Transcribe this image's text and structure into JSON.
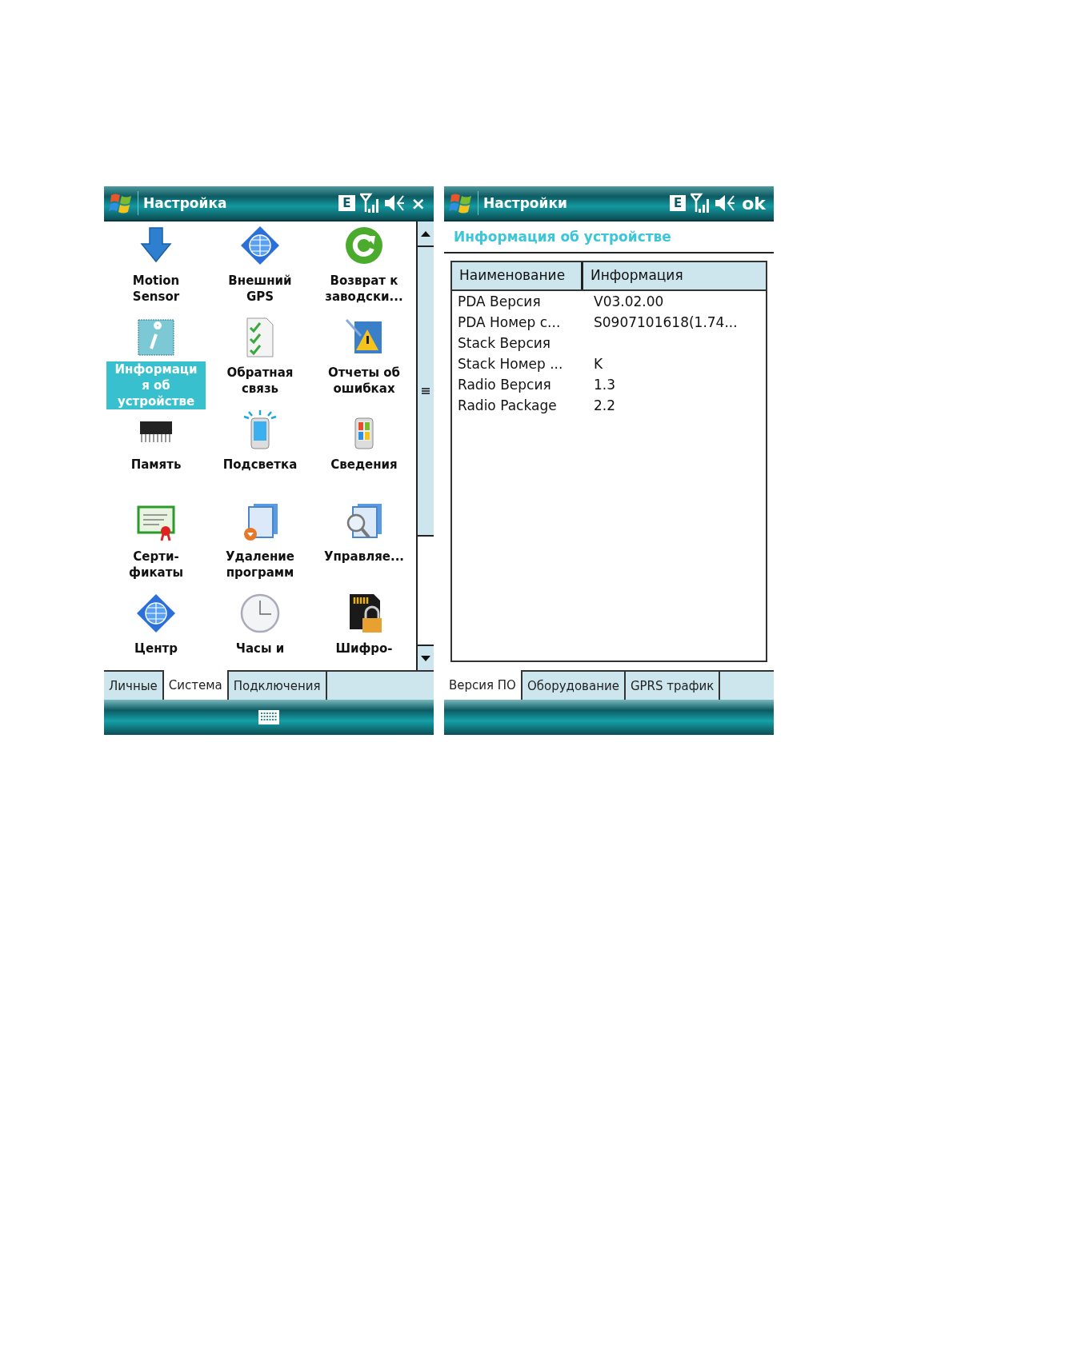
{
  "screens": [
    {
      "kind": "grid",
      "title": "Настройка",
      "network": "E",
      "action": "×",
      "keyboard": true,
      "items": [
        {
          "kind": "arrow",
          "lines": [
            "Motion",
            "Sensor"
          ],
          "selected": false
        },
        {
          "kind": "globe",
          "lines": [
            "Внешний",
            "GPS"
          ],
          "selected": false
        },
        {
          "kind": "refresh",
          "lines": [
            "Возврат к",
            "заводски..."
          ],
          "selected": false
        },
        {
          "kind": "info",
          "lines": [
            "Информаци",
            "я об",
            "устройстве"
          ],
          "selected": true
        },
        {
          "kind": "checklist",
          "lines": [
            "Обратная",
            "связь"
          ],
          "selected": false
        },
        {
          "kind": "warning",
          "lines": [
            "Отчеты об",
            "ошибках"
          ],
          "selected": false
        },
        {
          "kind": "chip",
          "lines": [
            "Память"
          ],
          "selected": false
        },
        {
          "kind": "phone",
          "lines": [
            "Подсветка"
          ],
          "selected": false
        },
        {
          "kind": "flagphone",
          "lines": [
            "Сведения"
          ],
          "selected": false
        },
        {
          "kind": "certificate",
          "lines": [
            "Серти-",
            "фикаты"
          ],
          "selected": false
        },
        {
          "kind": "appsremove",
          "lines": [
            "Удаление",
            "программ"
          ],
          "selected": false
        },
        {
          "kind": "appssearch",
          "lines": [
            "Управляе..."
          ],
          "selected": false
        },
        {
          "kind": "earth",
          "lines": [
            "Центр"
          ],
          "selected": false
        },
        {
          "kind": "clock",
          "lines": [
            "Часы и"
          ],
          "selected": false
        },
        {
          "kind": "sdlock",
          "lines": [
            "Шифро-"
          ],
          "selected": false
        }
      ],
      "tabs": [
        {
          "label": "Личные",
          "selected": false
        },
        {
          "label": "Система",
          "selected": true
        },
        {
          "label": "Подключения",
          "selected": false
        }
      ]
    },
    {
      "kind": "table",
      "title": "Настройки",
      "network": "E",
      "action": "ok",
      "keyboard": false,
      "heading": "Информация об устройстве",
      "columns": [
        "Наименование",
        "Информация"
      ],
      "rows": [
        [
          "PDA Версия",
          "V03.02.00"
        ],
        [
          "PDA Номер с...",
          "S0907101618(1.74..."
        ],
        [
          "Stack Версия",
          ""
        ],
        [
          "Stack Номер ...",
          "K"
        ],
        [
          "Radio Версия",
          "1.3"
        ],
        [
          "Radio Package",
          "2.2"
        ]
      ],
      "tabs": [
        {
          "label": "Версия ПО",
          "selected": true
        },
        {
          "label": "Оборудование",
          "selected": false
        },
        {
          "label": "GPRS трафик",
          "selected": false
        }
      ]
    }
  ]
}
